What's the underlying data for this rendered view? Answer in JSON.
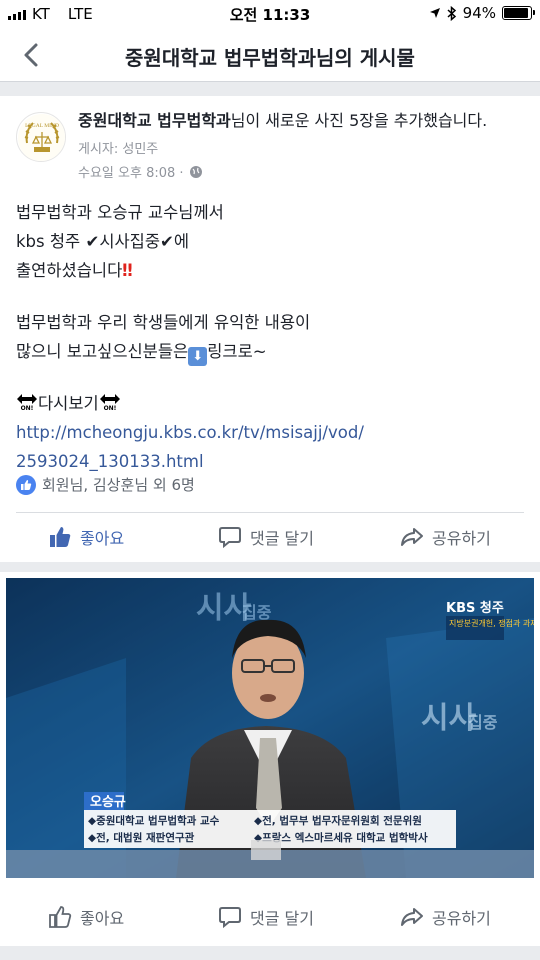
{
  "status_bar": {
    "carrier": "KT",
    "network": "LTE",
    "time": "오전 11:33",
    "battery": "94%",
    "battery_level": 0.94
  },
  "nav": {
    "title": "중원대학교 법무법학과님의 게시물"
  },
  "post": {
    "page_name": "중원대학교 법무법학과",
    "headline_suffix": "님이 새로운 사진 5장을 추가했습니다.",
    "poster_label": "게시자: 성민주",
    "timestamp": "수요일 오후 8:08 ·",
    "lines": {
      "l1": "법무법학과 오승규 교수님께서",
      "l2a": "kbs 청주 ",
      "l2b": "시사집중",
      "l2c": "에",
      "l3": "출연하셨습니다",
      "l4": "법무법학과 우리 학생들에게 유익한 내용이",
      "l5a": "많으니 보고싶으신분들은",
      "l5b": "링크로~",
      "l6": "다시보기",
      "link_line1": "http://mcheongju.kbs.co.kr/tv/msisajj/vod/",
      "link_line2": "2593024_130133.html"
    },
    "reactions_text": "회원님, 김상훈님 외 6명",
    "actions": {
      "like": "좋아요",
      "comment": "댓글 달기",
      "share": "공유하기"
    }
  },
  "photo": {
    "logo_text": "시사",
    "logo_sub": "집중",
    "kbs_badge": "KBS 청주",
    "kbs_caption": "지방분권개헌, 쟁점과 과제는?",
    "caption_name": "오승규",
    "caption_lines": [
      "◆중원대학교 법무법학과 교수",
      "◆전, 법무부 법무자문위원회 전문위원",
      "◆전, 대법원 재판연구관",
      "◆프랑스 엑스마르세유 대학교 법학박사"
    ],
    "actions": {
      "like": "좋아요",
      "comment": "댓글 달기",
      "share": "공유하기"
    }
  },
  "colors": {
    "facebook_blue": "#4267b2",
    "link_blue": "#365899",
    "background": "#e9ebee"
  }
}
